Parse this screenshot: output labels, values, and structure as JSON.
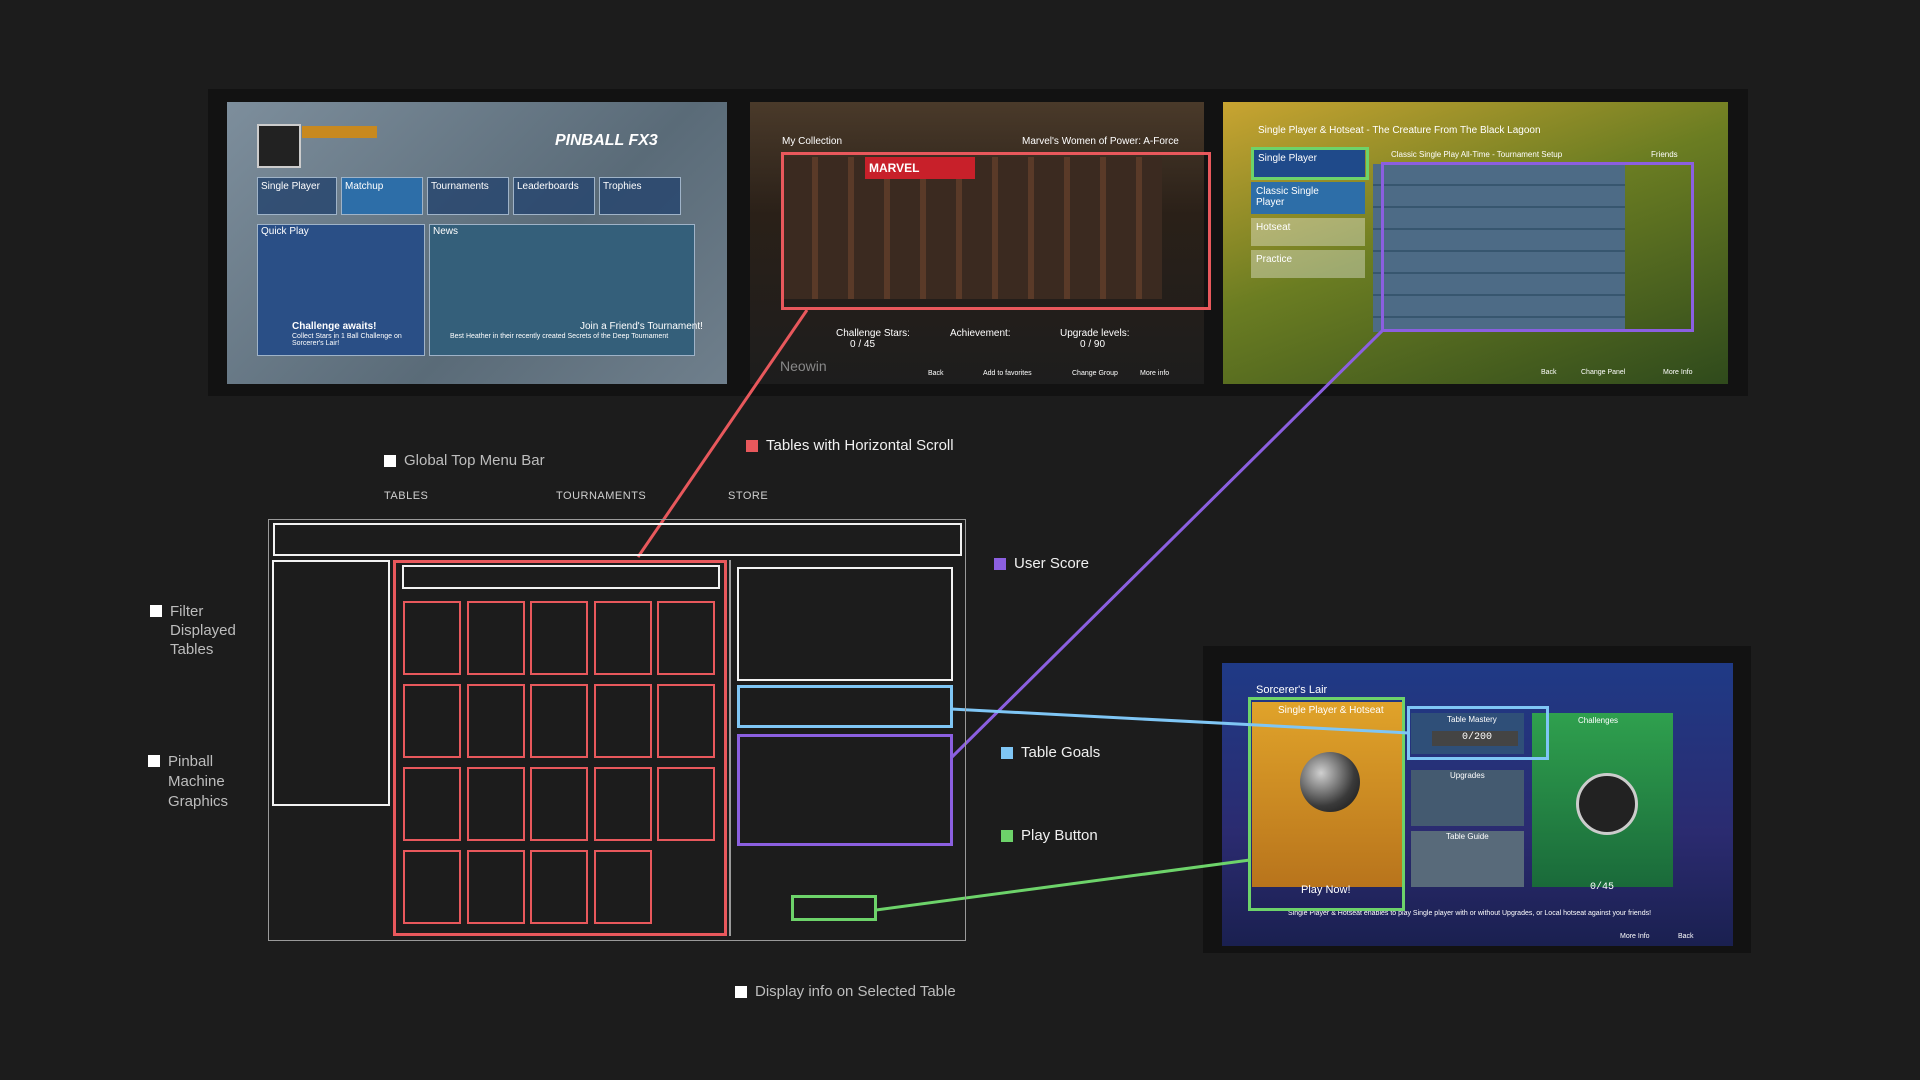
{
  "colors": {
    "background": "#1c1c1c",
    "tables_red": "#e8585c",
    "score_purple": "#8b5fe0",
    "goals_blue": "#7fc6f5",
    "play_green": "#6dd36a",
    "white": "#f2f2f2"
  },
  "legend": {
    "global_top_menu_bar": "Global Top Menu Bar",
    "tables_horizontal_scroll": "Tables with Horizontal Scroll",
    "user_score": "User Score",
    "table_goals": "Table Goals",
    "play_button": "Play Button",
    "filter_displayed_tables_1": "Filter",
    "filter_displayed_tables_2": "Displayed",
    "filter_displayed_tables_3": "Tables",
    "pinball_machine_graphics_1": "Pinball",
    "pinball_machine_graphics_2": "Machine",
    "pinball_machine_graphics_3": "Graphics",
    "display_info": "Display info on Selected Table"
  },
  "top_menu": {
    "tables": "TABLES",
    "tournaments": "TOURNAMENTS",
    "store": "STORE"
  },
  "shot1": {
    "logo": "PINBALL FX3",
    "menu": [
      "Single Player",
      "Matchup",
      "Tournaments",
      "Leaderboards",
      "Trophies"
    ],
    "quick_play": "Quick Play",
    "news": "News",
    "challenge_title": "Challenge awaits!",
    "challenge_text": "Collect Stars in 1 Ball Challenge on Sorcerer's Lair!",
    "news_title": "Join a Friend's Tournament!",
    "news_text": "Best Heather in their recently created Secrets of the Deep Tournament"
  },
  "shot2": {
    "title": "My Collection",
    "header_right": "Marvel's Women of Power: A-Force",
    "brand": "MARVEL",
    "challenge_stars": "Challenge Stars:",
    "achievement": "Achievement:",
    "upgrade_levels": "Upgrade levels:",
    "stars_value": "0 / 45",
    "upgrade_value": "0 / 90",
    "watermark": "Neowin",
    "footer": [
      "Back",
      "Add to favorites",
      "Change Group",
      "More info"
    ]
  },
  "shot3": {
    "title": "Single Player & Hotseat - The Creature From The Black Lagoon",
    "tab_single": "Single Player",
    "setup": "Classic Single Play All-Time - Tournament Setup",
    "friends": "Friends",
    "options": [
      "Classic Single Player",
      "Hotseat",
      "Practice"
    ],
    "footer": [
      "Back",
      "Change Panel",
      "More Info"
    ]
  },
  "shot4": {
    "title": "Sorcerer's Lair",
    "mode": "Single Player & Hotseat",
    "table_mastery": "Table Mastery",
    "mastery_value": "0/200",
    "upgrades": "Upgrades",
    "table_guide": "Table Guide",
    "challenges": "Challenges",
    "play_now": "Play Now!",
    "challenge_value": "0/45",
    "footer_text": "Single Player & Hotseat enables to play Single player with or without Upgrades, or Local hotseat against your friends!",
    "more_info": "More Info",
    "back": "Back"
  }
}
